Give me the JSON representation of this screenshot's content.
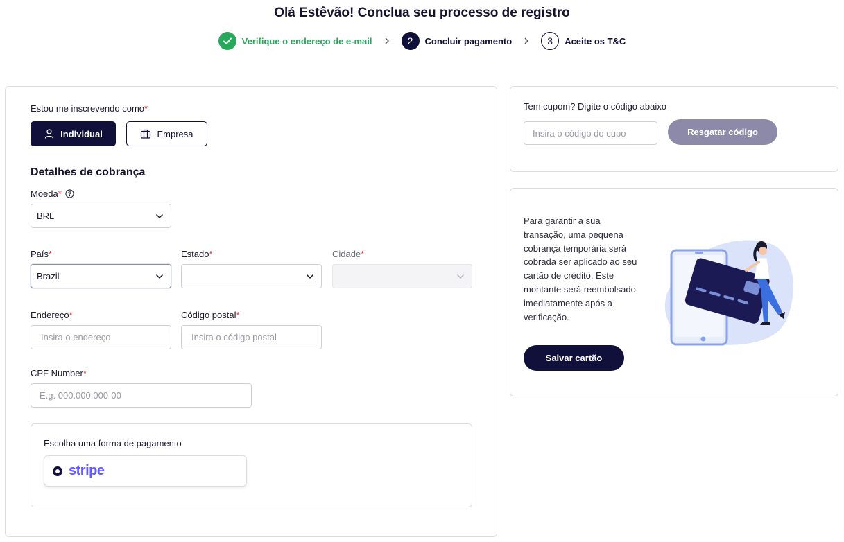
{
  "header": {
    "title": "Olá Estêvão! Conclua seu processo de registro",
    "steps": [
      {
        "number": "",
        "label": "Verifique o endereço de e-mail",
        "state": "done"
      },
      {
        "number": "2",
        "label": "Concluir pagamento",
        "state": "active"
      },
      {
        "number": "3",
        "label": "Aceite os T&C",
        "state": "todo"
      }
    ]
  },
  "registration": {
    "signup_as_label": "Estou me inscrevendo como",
    "required_mark": "*",
    "individual_label": "Individual",
    "company_label": "Empresa",
    "billing_title": "Detalhes de cobrança",
    "currency_label": "Moeda",
    "currency_value": "BRL",
    "country_label": "País",
    "country_value": "Brazil",
    "state_label": "Estado",
    "state_value": "",
    "city_label": "Cidade",
    "city_value": "",
    "address_label": "Endereço",
    "address_placeholder": "Insira o endereço",
    "postal_label": "Código postal",
    "postal_placeholder": "Insira o código postal",
    "cpf_label": "CPF Number",
    "cpf_placeholder": "E.g. 000.000.000-00",
    "payment_title": "Escolha uma forma de pagamento",
    "payment_option": "stripe"
  },
  "coupon": {
    "title": "Tem cupom? Digite o código abaixo",
    "placeholder": "Insira o código do cupo",
    "redeem_label": "Resgatar código"
  },
  "save_card": {
    "text": "Para garantir a sua transação, uma pequena cobrança temporária será cobrada ser aplicado ao seu cartão de crédito. Este montante será reembolsado imediatamente após a verificação.",
    "button_label": "Salvar cartão"
  },
  "colors": {
    "primary": "#11103a",
    "success": "#27a85b",
    "required": "#e0393e",
    "stripe": "#635bff",
    "redeem_disabled": "#8c8aa8"
  },
  "icons": {
    "check": "check-icon",
    "chevron_right": "chevron-right-icon",
    "user": "user-icon",
    "briefcase": "briefcase-icon",
    "help": "help-circle-icon",
    "chevron_down": "chevron-down-icon"
  }
}
